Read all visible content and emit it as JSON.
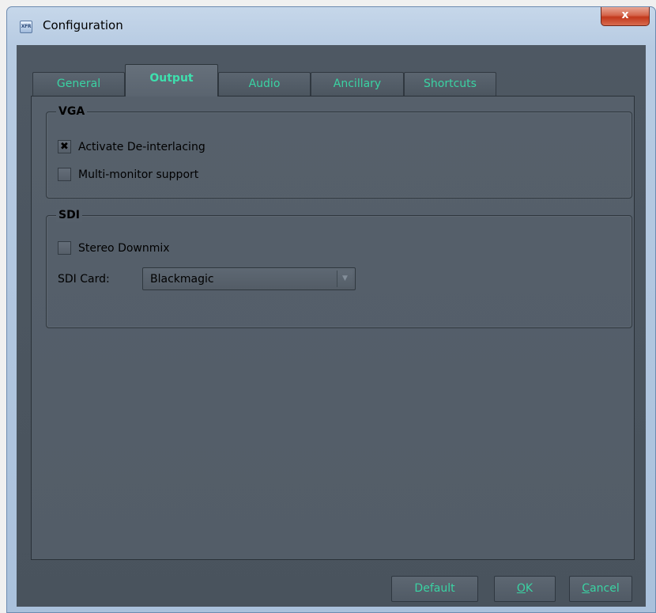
{
  "window": {
    "title": "Configuration",
    "icon_text": "XFR",
    "close_glyph": "x"
  },
  "tabs": [
    {
      "label": "General",
      "active": false
    },
    {
      "label": "Output",
      "active": true
    },
    {
      "label": "Audio",
      "active": false
    },
    {
      "label": "Ancillary",
      "active": false
    },
    {
      "label": "Shortcuts",
      "active": false
    }
  ],
  "vga": {
    "title": "VGA",
    "deinterlace": {
      "label": "Activate De-interlacing",
      "checked": true,
      "mark": "✖"
    },
    "multimonitor": {
      "label": "Multi-monitor support",
      "checked": false,
      "mark": ""
    }
  },
  "sdi": {
    "title": "SDI",
    "stereo_downmix": {
      "label": "Stereo Downmix",
      "checked": false,
      "mark": ""
    },
    "card_label": "SDI Card:",
    "card_value": "Blackmagic",
    "dropdown_arrow": "▼"
  },
  "buttons": {
    "default": "Default",
    "ok_prefix": "",
    "ok_underlined": "O",
    "ok_rest": "K",
    "cancel_underlined": "C",
    "cancel_rest": "ancel"
  },
  "colors": {
    "accent_text": "#3ad3a3",
    "panel_bg": "#56606b",
    "close_red": "#c2381c"
  },
  "icons": {
    "app": "app-icon",
    "close": "close-icon",
    "checkbox_mark": "x-mark-icon",
    "dropdown": "chevron-down-icon"
  }
}
